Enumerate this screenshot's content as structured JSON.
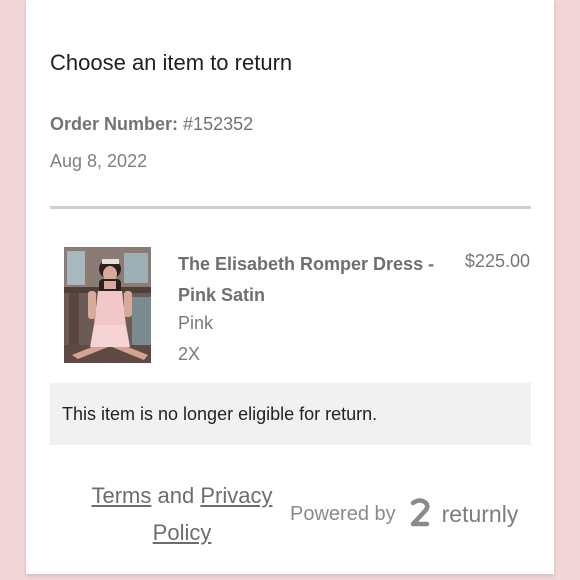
{
  "page": {
    "title": "Choose an item to return",
    "order_number_label": "Order Number:",
    "order_number_value": "#152352",
    "date": "Aug 8, 2022"
  },
  "item": {
    "name": "The Elisabeth Romper Dress - Pink Satin",
    "price": "$225.00",
    "color": "Pink",
    "size": "2X",
    "image_icon": "product-photo",
    "notice": "This item is no longer eligible for return."
  },
  "footer": {
    "terms_label": "Terms",
    "and_text": "and",
    "privacy_label": "Privacy Policy",
    "powered_by": "Powered by",
    "brand": "returnly",
    "brand_icon": "returnly-logo"
  },
  "colors": {
    "page_background": "#f1d5d7",
    "card_background": "#ffffff",
    "notice_background": "#f1f1f1",
    "divider": "#cfcfcf"
  }
}
